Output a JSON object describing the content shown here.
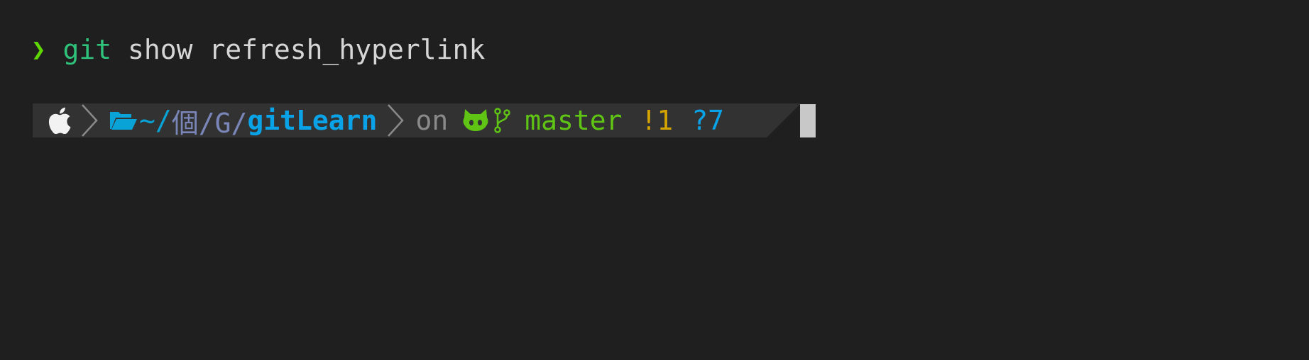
{
  "terminal": {
    "previous_command": {
      "prompt_symbol": "❯",
      "command": "git",
      "args": " show refresh_hyperlink"
    },
    "prompt": {
      "os_icon": "apple-icon",
      "path_icon": "folder-open-icon",
      "path_home": "~/",
      "path_mid": "個/G/",
      "path_current": "gitLearn",
      "on_label": "on",
      "vcs_icon": "github-cat-icon",
      "branch_icon": "git-branch-icon",
      "branch": "master",
      "modified": "!1",
      "untracked": "?7"
    },
    "colors": {
      "background": "#1f1f1f",
      "segment_bg": "#323232",
      "prompt_symbol": "#5fd700",
      "command": "#2fc27b",
      "path": "#0aa3e8",
      "branch": "#5fc414",
      "modified": "#d4a400",
      "untracked": "#0aa3e8"
    }
  }
}
